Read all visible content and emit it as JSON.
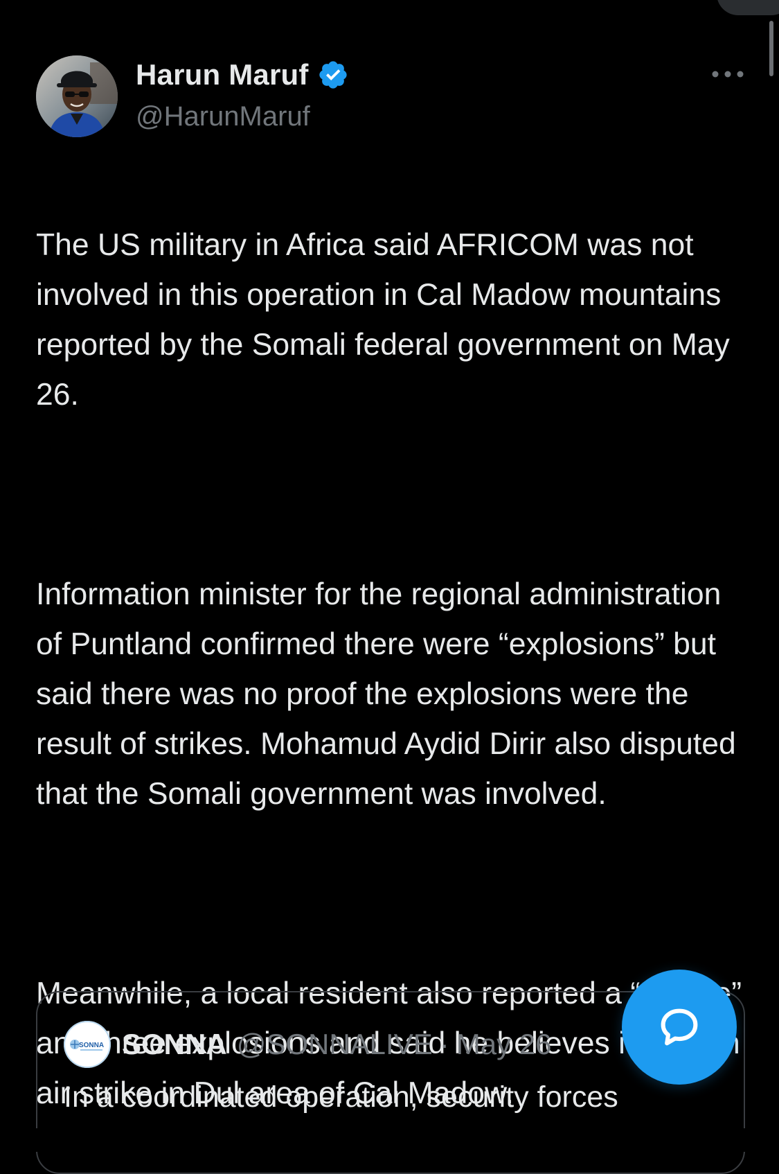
{
  "tweet": {
    "author": {
      "display_name": "Harun Maruf",
      "handle": "@HarunMaruf",
      "verified": true
    },
    "paragraphs": [
      "The US military in Africa said AFRICOM was not involved in this operation in Cal Madow mountains reported by the Somali federal government on May 26.",
      "Information minister for the regional administration of Puntland confirmed there were “explosions” but said there was no proof the explosions were the result of strikes. Mohamud Aydid Dirir also disputed that the Somali government was involved.",
      "Meanwhile, a local resident also reported a “middle” and three explosions and said he believes it was an air strike in Dul area of Cal Madow."
    ]
  },
  "quote": {
    "author": {
      "display_name": "SONNA",
      "handle": "@SONNALIVE",
      "separator": "·",
      "date": "May 26",
      "avatar_text": "SONNA"
    },
    "text": "In a coordinated operation, security forces"
  },
  "icons": {
    "verified": "verified-badge-icon",
    "more": "more-horizontal-icon",
    "fab": "reply-bubble-icon"
  },
  "colors": {
    "background": "#000000",
    "text": "#e7e9ea",
    "secondary_text": "#71767b",
    "accent": "#1d9bf0",
    "border": "#3a3d41"
  }
}
